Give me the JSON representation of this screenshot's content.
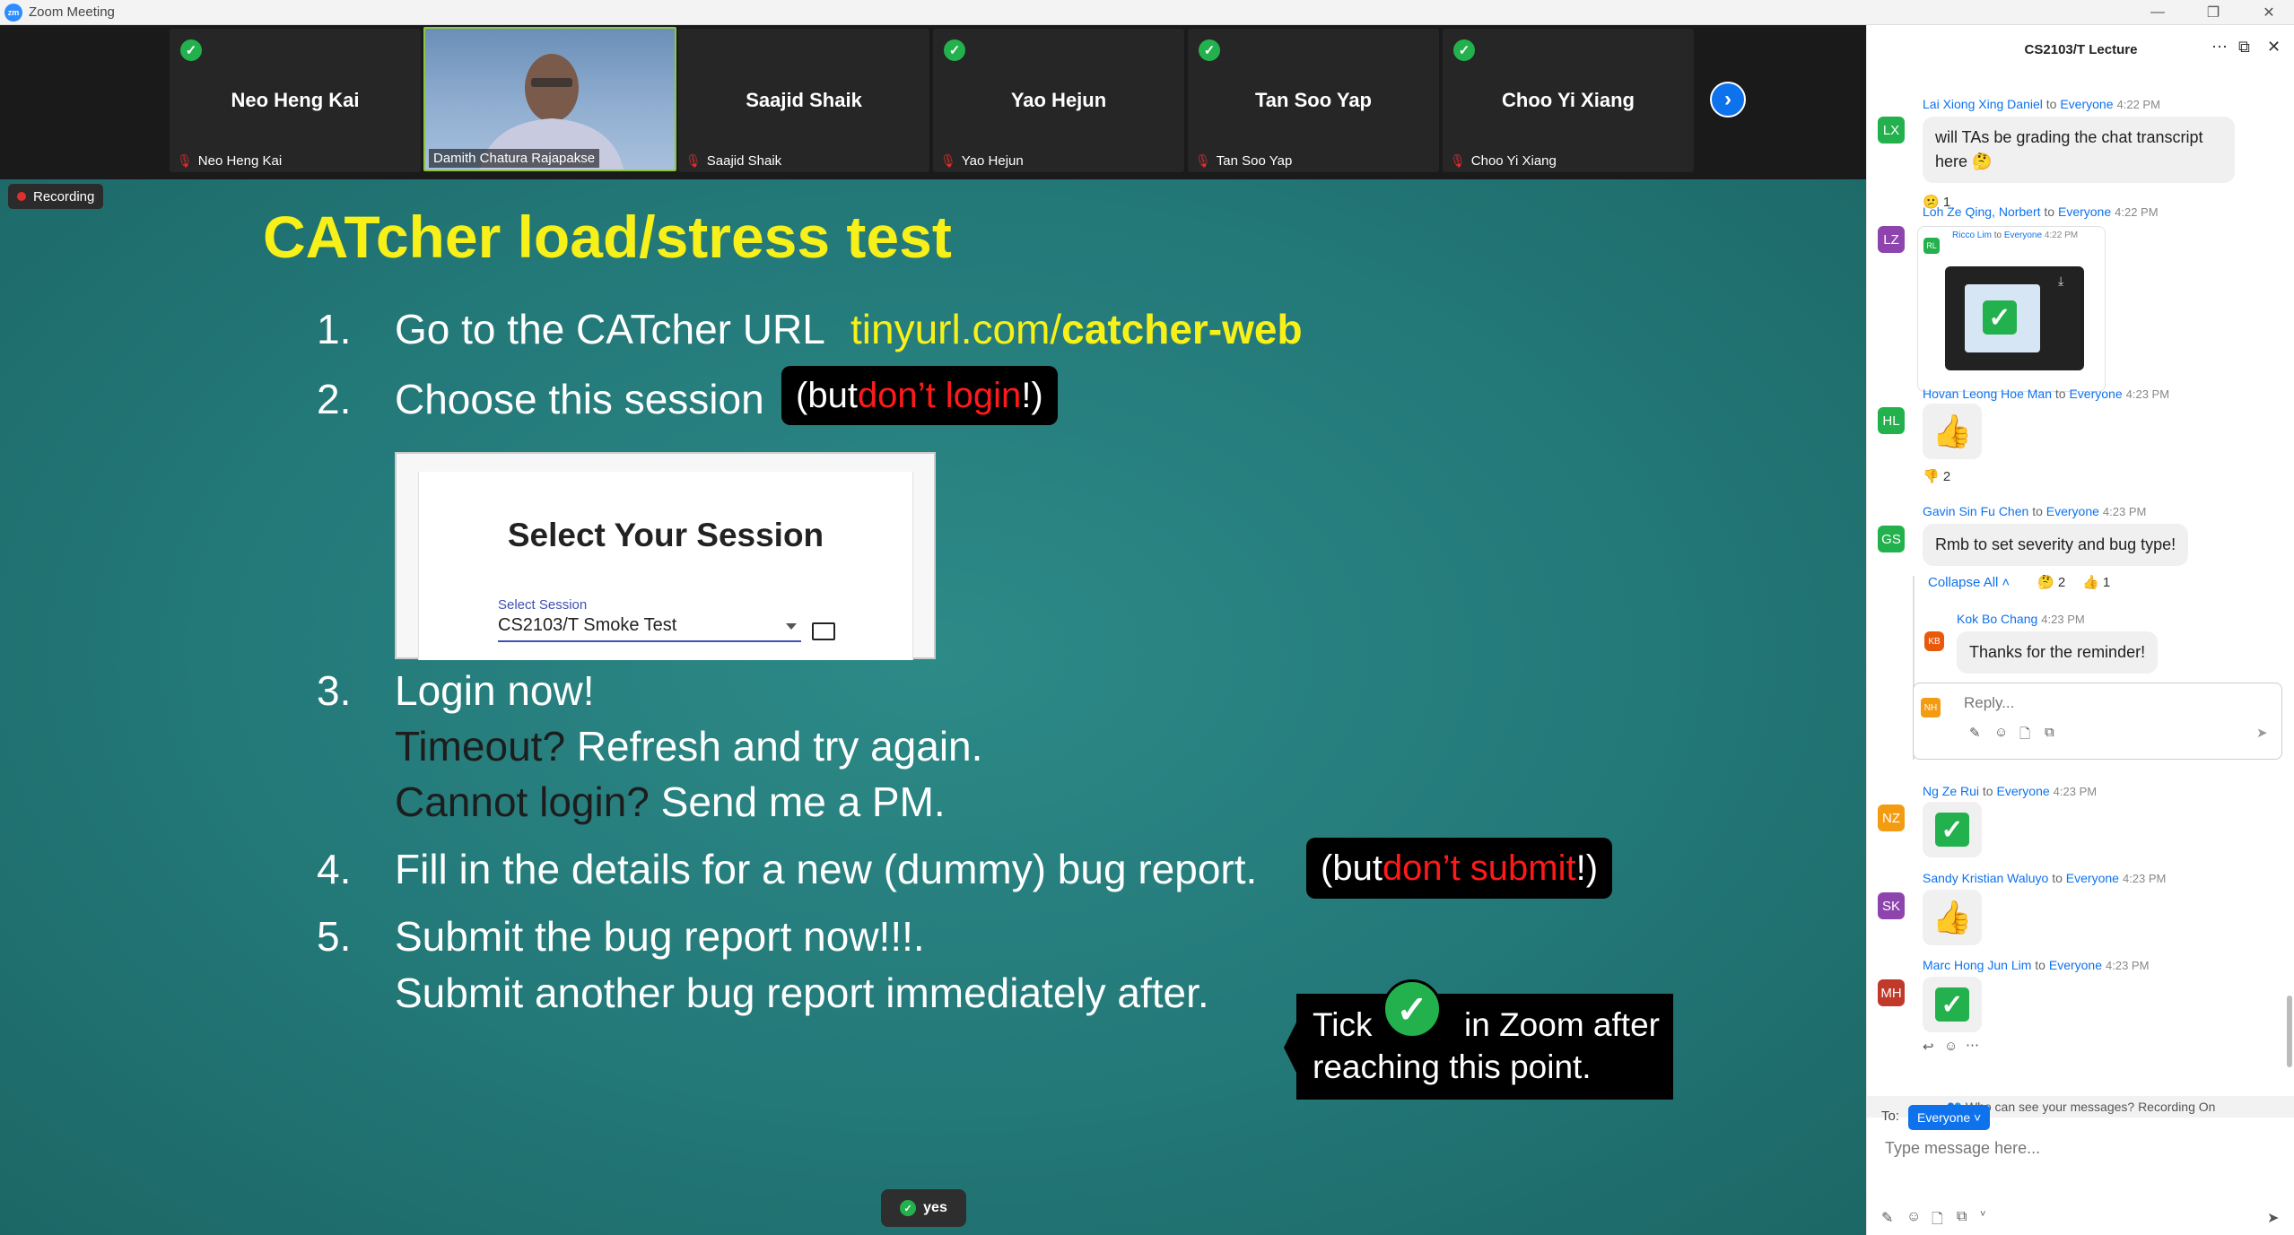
{
  "window": {
    "title": "Zoom Meeting",
    "logo": "zm"
  },
  "gallery": {
    "participants": [
      {
        "big": "Neo Heng Kai",
        "small": "Neo Heng Kai",
        "muted": true,
        "raised_check": true
      },
      {
        "big": "",
        "small": "Damith Chatura Rajapakse",
        "video": true
      },
      {
        "big": "Saajid Shaik",
        "small": "Saajid Shaik",
        "muted": true,
        "raised_check": false
      },
      {
        "big": "Yao Hejun",
        "small": "Yao Hejun",
        "muted": true,
        "raised_check": true
      },
      {
        "big": "Tan Soo Yap",
        "small": "Tan Soo Yap",
        "muted": true,
        "raised_check": true
      },
      {
        "big": "Choo Yi Xiang",
        "small": "Choo Yi Xiang",
        "muted": true,
        "raised_check": true
      }
    ]
  },
  "recording": {
    "label": "Recording"
  },
  "slide": {
    "title": "CATcher load/stress test",
    "items": [
      {
        "num": "1.",
        "text": "Go to the CATcher URL",
        "url_plain": "tinyurl.com/",
        "url_bold": "catcher-web"
      },
      {
        "num": "2.",
        "text": "Choose this session",
        "note_pre": "(but ",
        "note_red": "don’t login",
        "note_post": "!)"
      },
      {
        "num": "3.",
        "text": "Login now!",
        "sub1_dark": "Timeout?",
        "sub1": " Refresh and try again.",
        "sub2_dark": "Cannot login?",
        "sub2": " Send me a PM."
      },
      {
        "num": "4.",
        "text": "Fill in the details for a new (dummy) bug report.",
        "note_pre": "(but ",
        "note_red": "don’t submit",
        "note_post": "!)"
      },
      {
        "num": "5.",
        "text": "Submit the bug report now!!!.",
        "sub1": "Submit another bug report immediately after."
      }
    ],
    "session_image": {
      "heading": "Select Your Session",
      "label": "Select Session",
      "value": "CS2103/T Smoke Test"
    },
    "tick_box": {
      "word1": "Tick",
      "word2": "in Zoom after",
      "line2": "reaching this point."
    }
  },
  "reaction_pill": {
    "label": "yes"
  },
  "chat": {
    "title": "CS2103/T Lecture",
    "messages": [
      {
        "initials": "LX",
        "color": "#23b14d",
        "sender": "Lai Xiong Xing Daniel",
        "to": "to",
        "target": "Everyone",
        "time": "4:22 PM",
        "text": "will TAs be grading the chat transcript here 🤔",
        "reactions": "😕 1"
      },
      {
        "initials": "LZ",
        "color": "#8e44ad",
        "sender": "Loh Ze Qing, Norbert",
        "to": "to",
        "target": "Everyone",
        "time": "4:22 PM",
        "image_sender": "Ricco Lim",
        "image_to": "to",
        "image_target": "Everyone",
        "image_time": "4:22 PM",
        "image_initials": "RL"
      },
      {
        "initials": "HL",
        "color": "#23b14d",
        "sender": "Hovan Leong Hoe Man",
        "to": "to",
        "target": "Everyone",
        "time": "4:23 PM",
        "reactions": "👎 2"
      },
      {
        "initials": "GS",
        "color": "#23b14d",
        "sender": "Gavin Sin Fu Chen",
        "to": "to",
        "target": "Everyone",
        "time": "4:23 PM",
        "text": "Rmb to set severity and bug type!",
        "collapse": "Collapse All",
        "reactions_a": "🤔 2",
        "reactions_b": "👍 1"
      },
      {
        "initials": "KB",
        "color": "#e8590c",
        "sender": "Kok Bo Chang",
        "time": "4:23 PM",
        "text": "Thanks for the reminder!"
      },
      {
        "initials": "NZ",
        "color": "#f39c12",
        "sender": "Ng Ze Rui",
        "to": "to",
        "target": "Everyone",
        "time": "4:23 PM"
      },
      {
        "initials": "SK",
        "color": "#8e44ad",
        "sender": "Sandy Kristian Waluyo",
        "to": "to",
        "target": "Everyone",
        "time": "4:23 PM"
      },
      {
        "initials": "MH",
        "color": "#c0392b",
        "sender": "Marc Hong Jun Lim",
        "to": "to",
        "target": "Everyone",
        "time": "4:23 PM"
      }
    ],
    "reply": {
      "initials": "NH",
      "color": "#f39c12",
      "placeholder": "Reply..."
    },
    "visibility_note": "Who can see your messages? Recording On",
    "to_label": "To:",
    "to_target": "Everyone",
    "input_placeholder": "Type message here..."
  }
}
